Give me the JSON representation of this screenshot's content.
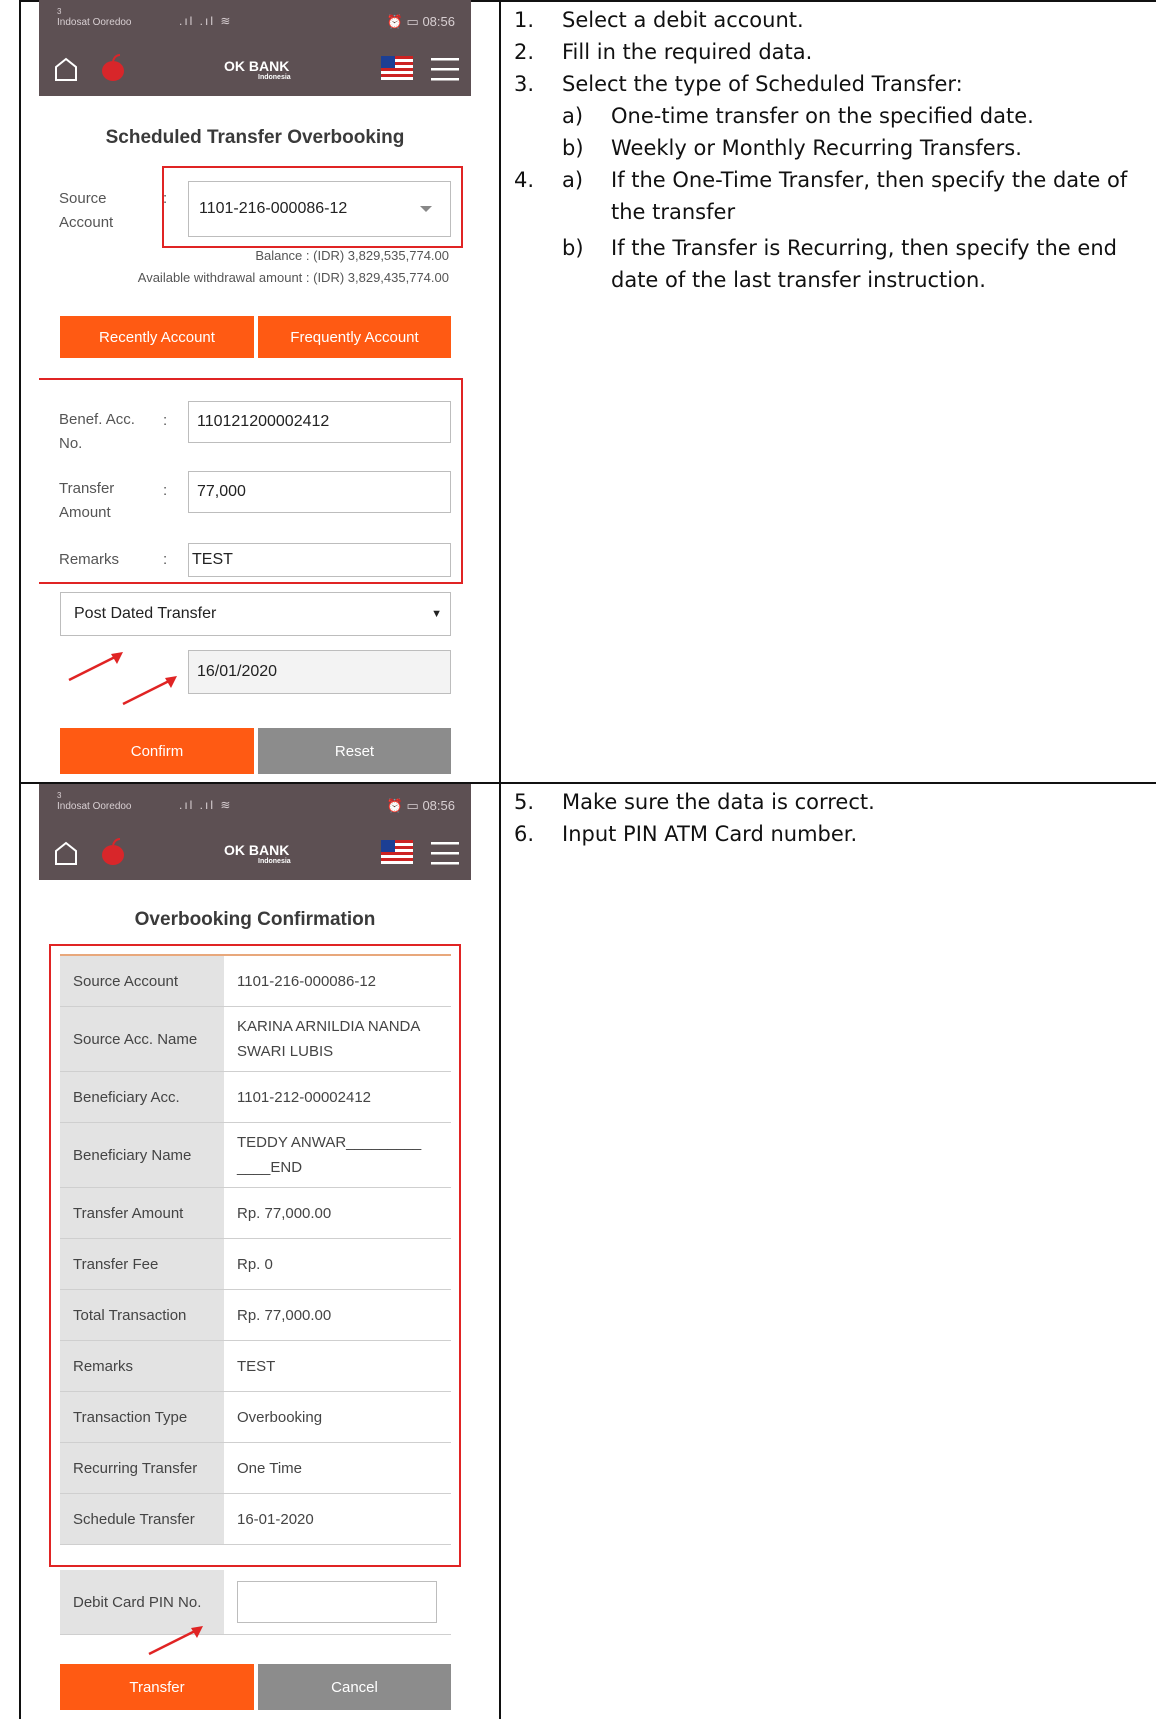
{
  "screen1": {
    "status": {
      "carrier_num": "3",
      "carrier": "Indosat Ooredoo",
      "signal": ".ıl .ıl ≋",
      "time": "08:56"
    },
    "logo": {
      "brand": "OK BANK",
      "sub": "Indonesia"
    },
    "title": "Scheduled Transfer Overbooking",
    "source": {
      "label_1": "Source",
      "label_2": "Account",
      "value": "1101-216-000086-12"
    },
    "balance": "Balance : (IDR) 3,829,535,774.00",
    "available": "Available withdrawal amount : (IDR) 3,829,435,774.00",
    "recently_button": "Recently Account",
    "frequently_button": "Frequently Account",
    "benef": {
      "label_1": "Benef. Acc.",
      "label_2": "No.",
      "value": "110121200002412"
    },
    "amount": {
      "label_1": "Transfer",
      "label_2": "Amount",
      "value": "77,000"
    },
    "remarks": {
      "label": "Remarks",
      "value": "TEST"
    },
    "transfer_type": "Post Dated Transfer",
    "date": "16/01/2020",
    "confirm_button": "Confirm",
    "reset_button": "Reset"
  },
  "screen2": {
    "title": "Overbooking Confirmation",
    "rows": [
      {
        "k": "Source Account",
        "v": "1101-216-000086-12"
      },
      {
        "k": "Source Acc. Name",
        "v": "KARINA ARNILDIA NANDA SWARI LUBIS"
      },
      {
        "k": "Beneficiary Acc.",
        "v": "1101-212-00002412"
      },
      {
        "k": "Beneficiary Name",
        "v": "TEDDY ANWAR_________ ____END"
      },
      {
        "k": "Transfer Amount",
        "v": "Rp. 77,000.00"
      },
      {
        "k": "Transfer Fee",
        "v": "Rp. 0"
      },
      {
        "k": "Total Transaction",
        "v": "Rp. 77,000.00"
      },
      {
        "k": "Remarks",
        "v": "TEST"
      },
      {
        "k": "Transaction Type",
        "v": "Overbooking"
      },
      {
        "k": "Recurring Transfer",
        "v": "One Time"
      },
      {
        "k": "Schedule Transfer",
        "v": "16-01-2020"
      }
    ],
    "pin_label": "Debit Card PIN No.",
    "pin_value": "",
    "transfer_button": "Transfer",
    "cancel_button": "Cancel"
  },
  "instructions1": [
    {
      "n": "1.",
      "t": "Select a debit account."
    },
    {
      "n": "2.",
      "t": "Fill in the required data."
    },
    {
      "n": "3.",
      "t": "Select the type of Scheduled Transfer:"
    },
    {
      "n": "a)",
      "t": "One-time transfer on the specified date."
    },
    {
      "n": "b)",
      "t": "Weekly or Monthly Recurring Transfers."
    },
    {
      "n": "4.",
      "t": "a)"
    },
    {
      "t": "If the One-Time Transfer, then specify the date of"
    },
    {
      "t": "the transfer"
    },
    {
      "n": "b)",
      "t": "If the Transfer is Recurring, then specify the end"
    },
    {
      "t": "date of the last transfer instruction."
    }
  ],
  "instructions2": [
    {
      "n": "5.",
      "t": "Make sure the data is correct."
    },
    {
      "n": "6.",
      "t": "Input PIN ATM Card number."
    }
  ],
  "colors": {
    "orange": "#ff5a13",
    "grey": "#8c8c8c",
    "header": "#5d5053",
    "highlight": "#e02424"
  }
}
